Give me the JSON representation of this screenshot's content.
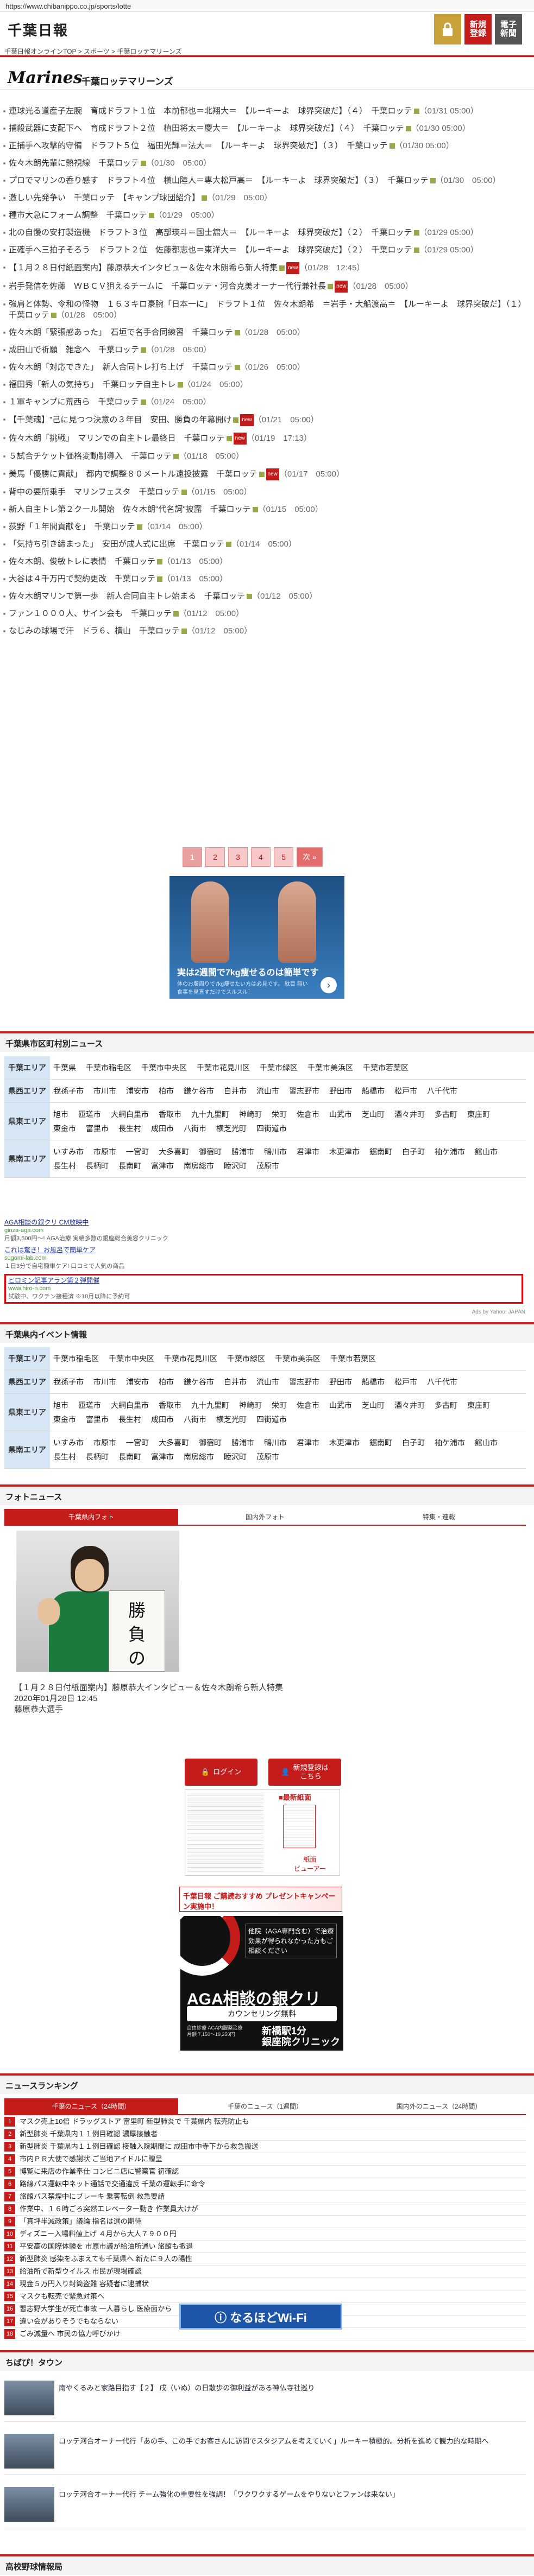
{
  "url": "https://www.chibanippo.co.jp/sports/lotte",
  "header": {
    "logo": "千葉日報",
    "btn_login": "",
    "btn_register": "新規\n登録",
    "btn_digital": "電子\n新聞"
  },
  "breadcrumb": "千葉日報オンラインTOP > スポーツ > 千葉ロッテマリーンズ",
  "team": {
    "logo": "Marines",
    "name": "千葉ロッテマリーンズ"
  },
  "news": [
    {
      "text": "連球光る道産子左腕　育成ドラフト１位　本前郁也＝北翔大＝　【ルーキーよ　球界突破だ】（４）　千葉ロッテ",
      "date": "（01/31 05:00）",
      "badge": ""
    },
    {
      "text": "捕殺武器に支配下へ　育成ドラフト２位　植田将太＝慶大＝　【ルーキーよ　球界突破だ】（４）　千葉ロッテ",
      "date": "（01/30 05:00）",
      "badge": ""
    },
    {
      "text": "正捕手へ攻撃的守備　ドラフト５位　福田光輝＝法大＝　【ルーキーよ　球界突破だ】（３）　千葉ロッテ",
      "date": "（01/30 05:00）",
      "badge": ""
    },
    {
      "text": "佐々木朗先輩に熱視線　千葉ロッテ",
      "date": "（01/30　05:00）",
      "badge": ""
    },
    {
      "text": "プロでマリンの香り感す　ドラフト４位　横山陸人＝専大松戸高＝　【ルーキーよ　球界突破だ】（３）　千葉ロッテ",
      "date": "（01/30　05:00）",
      "badge": ""
    },
    {
      "text": "激しい先発争い　千葉ロッテ　【キャンプ球団紹介】",
      "date": "（01/29　05:00）",
      "badge": ""
    },
    {
      "text": "種市大急にフォーム調整　千葉ロッテ",
      "date": "（01/29　05:00）",
      "badge": ""
    },
    {
      "text": "北の自慢の安打製造機　ドラフト３位　高部瑛斗＝国士舘大＝　【ルーキーよ　球界突破だ】（２）　千葉ロッテ",
      "date": "（01/29 05:00）",
      "badge": ""
    },
    {
      "text": "正確手へ三拍子そろう　ドラフト２位　佐藤都志也＝東洋大＝　【ルーキーよ　球界突破だ】（２）　千葉ロッテ",
      "date": "（01/29 05:00）",
      "badge": ""
    },
    {
      "text": "【１月２８日付紙面案内】藤原恭大インタビュー＆佐々木朗希ら新人特集",
      "date": "（01/28　12:45）",
      "badge": "new"
    },
    {
      "text": "岩手発信を佐藤　ＷＢＣＶ狙えるチームに　千葉ロッテ・河合克美オーナー代行兼社長",
      "date": "（01/28　05:00）",
      "badge": "new"
    },
    {
      "text": "強肩と体勢、令和の怪物　１６３キロ豪腕「日本一に」　ドラフト１位　佐々木朗希　＝岩手・大船渡高＝　【ルーキーよ　球界突破だ】（１）　千葉ロッテ",
      "date": "（01/28　05:00）",
      "badge": ""
    },
    {
      "text": "佐々木朗「緊張感あった」　石垣で名手合同練習　千葉ロッテ",
      "date": "（01/28　05:00）",
      "badge": ""
    },
    {
      "text": "成田山で祈願　雑念へ　千葉ロッテ",
      "date": "（01/28　05:00）",
      "badge": ""
    },
    {
      "text": "佐々木朗「対応できた」　新人合同トレ打ち上げ　千葉ロッテ",
      "date": "（01/26　05:00）",
      "badge": ""
    },
    {
      "text": "福田秀「新人の気持ち」　千葉ロッテ自主トレ",
      "date": "（01/24　05:00）",
      "badge": ""
    },
    {
      "text": "１軍キャンプに荒西ら　千葉ロッテ",
      "date": "（01/24　05:00）",
      "badge": ""
    },
    {
      "text": "【千葉魂】\"己に見つつ決意の３年目　安田、勝負の年幕開け",
      "date": "（01/21　05:00）",
      "badge": "new"
    },
    {
      "text": "佐々木朗「挑戦」　マリンでの自主トレ最終日　千葉ロッテ",
      "date": "（01/19　17:13）",
      "badge": "new"
    },
    {
      "text": "５試合チケット価格変動制導入　千葉ロッテ",
      "date": "（01/18　05:00）",
      "badge": ""
    },
    {
      "text": "美馬「優勝に貢献」　都内で調整８０メートル遠投披露　千葉ロッテ",
      "date": "（01/17　05:00）",
      "badge": "new"
    },
    {
      "text": "背中の要所乗手　マリンフェスタ　千葉ロッテ",
      "date": "（01/15　05:00）",
      "badge": ""
    },
    {
      "text": "新人自主トレ第２クール開始　佐々木朗\"代名詞\"披露　千葉ロッテ",
      "date": "（01/15　05:00）",
      "badge": ""
    },
    {
      "text": "荻野「１年間貢献を」　千葉ロッテ",
      "date": "（01/14　05:00）",
      "badge": ""
    },
    {
      "text": "「気持ち引き締まった」　安田が成人式に出席　千葉ロッテ",
      "date": "（01/14　05:00）",
      "badge": ""
    },
    {
      "text": "佐々木朗、俊敏トレに表情　千葉ロッテ",
      "date": "（01/13　05:00）",
      "badge": ""
    },
    {
      "text": "大谷は４千万円で契約更改　千葉ロッテ",
      "date": "（01/13　05:00）",
      "badge": ""
    },
    {
      "text": "佐々木朗マリンで第一歩　新人合同自主トレ始まる　千葉ロッテ",
      "date": "（01/12　05:00）",
      "badge": ""
    },
    {
      "text": "ファン１０００人、サイン会も　千葉ロッテ",
      "date": "（01/12　05:00）",
      "badge": ""
    },
    {
      "text": "なじみの球場で汗　ドラ６、横山　千葉ロッテ",
      "date": "（01/12　05:00）",
      "badge": ""
    }
  ],
  "pager": [
    "1",
    "2",
    "3",
    "4",
    "5",
    "次 »"
  ],
  "ad_main": {
    "headline": "実は2週間で7kg痩せるのは簡単です",
    "sub": "体のお腹周りで7kg痩せたい方は必見です。 駄目 無い食事を見直すだけでスルスル！"
  },
  "section_city": "千葉県市区町村別ニュース",
  "areas_city": [
    {
      "label": "千葉エリア",
      "items": [
        "千葉県",
        "千葉市稲毛区",
        "千葉市中央区",
        "千葉市花見川区",
        "千葉市緑区",
        "千葉市美浜区",
        "千葉市若葉区"
      ]
    },
    {
      "label": "県西エリア",
      "items": [
        "我孫子市",
        "市川市",
        "浦安市",
        "柏市",
        "鎌ケ谷市",
        "白井市",
        "流山市",
        "習志野市",
        "野田市",
        "船橋市",
        "松戸市",
        "八千代市"
      ]
    },
    {
      "label": "県東エリア",
      "items": [
        "旭市",
        "匝瑳市",
        "大網白里市",
        "香取市",
        "九十九里町",
        "神崎町",
        "栄町",
        "佐倉市",
        "山武市",
        "芝山町",
        "酒々井町",
        "多古町",
        "東庄町",
        "東金市",
        "富里市",
        "長生村",
        "成田市",
        "八街市",
        "横芝光町",
        "四街道市"
      ]
    },
    {
      "label": "県南エリア",
      "items": [
        "いすみ市",
        "市原市",
        "一宮町",
        "大多喜町",
        "御宿町",
        "勝浦市",
        "鴨川市",
        "君津市",
        "木更津市",
        "鋸南町",
        "白子町",
        "袖ケ浦市",
        "館山市",
        "長生村",
        "長柄町",
        "長南町",
        "富津市",
        "南房総市",
        "睦沢町",
        "茂原市"
      ]
    }
  ],
  "text_ads": [
    {
      "title": "AGA相談の銀クリ CM放映中",
      "url": "ginza-aga.com",
      "desc": "月額3,500円〜! AGA治療 実績多数の銀座総合美容クリニック"
    },
    {
      "title": "これは驚き！お風呂で簡単ケア",
      "url": "sugomi-lab.com",
      "desc": "１日3分で自宅簡単ケア! 口コミで人気の商品"
    },
    {
      "title": "ヒロミン記事アラン第２弾開催",
      "url": "www.hiro-n.com",
      "desc": "試験中、ワクチン接種済 ※10月以降に予約可"
    }
  ],
  "ads_by": "Ads by Yahoo! JAPAN",
  "section_event": "千葉県内イベント情報",
  "areas_event": [
    {
      "label": "千葉エリア",
      "items": [
        "千葉市稲毛区",
        "千葉市中央区",
        "千葉市花見川区",
        "千葉市緑区",
        "千葉市美浜区",
        "千葉市若葉区"
      ]
    },
    {
      "label": "県西エリア",
      "items": [
        "我孫子市",
        "市川市",
        "浦安市",
        "柏市",
        "鎌ケ谷市",
        "白井市",
        "流山市",
        "習志野市",
        "野田市",
        "船橋市",
        "松戸市",
        "八千代市"
      ]
    },
    {
      "label": "県東エリア",
      "items": [
        "旭市",
        "匝瑳市",
        "大網白里市",
        "香取市",
        "九十九里町",
        "神崎町",
        "栄町",
        "佐倉市",
        "山武市",
        "芝山町",
        "酒々井町",
        "多古町",
        "東庄町",
        "東金市",
        "富里市",
        "長生村",
        "成田市",
        "八街市",
        "横芝光町",
        "四街道市"
      ]
    },
    {
      "label": "県南エリア",
      "items": [
        "いすみ市",
        "市原市",
        "一宮町",
        "大多喜町",
        "御宿町",
        "勝浦市",
        "鴨川市",
        "君津市",
        "木更津市",
        "鋸南町",
        "白子町",
        "袖ケ浦市",
        "館山市",
        "長生村",
        "長柄町",
        "長南町",
        "富津市",
        "南房総市",
        "睦沢町",
        "茂原市"
      ]
    }
  ],
  "section_photo": "フォトニュース",
  "photo_tabs": [
    "千葉県内フォト",
    "国内外フォト",
    "特集・連載"
  ],
  "photo": {
    "board": "勝\n負\nの\n年",
    "caption1": "【１月２８日付紙面案内】藤原恭大インタビュー＆佐々木朗希ら新人特集",
    "caption2": "2020年01月28日 12:45",
    "caption3": "藤原恭大選手"
  },
  "login_btn": "ログイン",
  "register_btn": "新規登録は\nこちら",
  "viewer": {
    "label": "■最新紙面",
    "sub": "紙面\nビューアー"
  },
  "banner2": "千葉日報 ご購読おすすめ プレゼントキャンペーン実施中！",
  "aga": {
    "t1": "他院（AGA専門含む）で治療効果が得られなかった方もご相談ください",
    "t2": "AGA相談の銀クリ",
    "t3": "カウンセリング無料",
    "t4": "自由診療 AGA内服薬治療\n月額 7,150〜19,250円",
    "t5": "新橋駅1分\n銀座院クリニック"
  },
  "section_rank": "ニュースランキング",
  "rank_tabs": [
    "千葉のニュース（24時間）",
    "千葉のニュース（1週間）",
    "国内外のニュース（24時間）"
  ],
  "ranking": [
    "マスク売上10倍 ドラッグストア 富里町 新型肺炎で 千葉県内 転売防止も",
    "新型肺炎 千葉県内１１例目確認 濃厚接触者",
    "新型肺炎 千葉県内１１例目確認 接触入院期間に 成田市中寺下から救急搬送",
    "市内ＰＲ大使で感謝状 ご当地アイドルに贈呈",
    "博覧に来店の作業奉仕 コンビニ店に警察官 初確認",
    "路線パス運転中ネット通話で交通違反 千葉の運転手に命令",
    "旅館パス禁煙中にブレーキ 乗客転倒 救急要請",
    "作業中、１６時ごろ突然エレベーター動き 作業員大けが",
    "「真坪半減政策」議論 指名は選の期待",
    "ディズニー入場料値上げ ４月から大人７９００円",
    "平安高の国際体験を 市原市議が給油所通い 旅館も撤退",
    "新型肺炎 感染をふまえても千葉県へ 新たに９人の陽性",
    "給油所で新型ウイルス 市民が現場確認",
    "現金５万円入り封筒盗難 容疑者に逮捕状",
    "マスクも転売で緊急対策へ",
    "習志野大学生が死亡事故 一人暮らし 医療面から",
    "違い会がありそうでもならない",
    "ごみ減量へ 市民の協力呼びかけ"
  ],
  "wifi": "なるほどWi-Fi",
  "section_town": "ちばぴ！タウン",
  "town": [
    {
      "text": "南やくるみと家路目指す【２】 戌（いぬ）の日散歩の御利益がある神仏寺社巡り"
    },
    {
      "text": "ロッテ河合オーナー代行「あの手、この手でお客さんに訪問でスタジアムを考えていく」ルーキー積極的。分析を進めて観力的な時期へ"
    },
    {
      "text": "ロッテ河合オーナー代行 チーム強化の重要性を強調！「ワクワクするゲームをやりないとファンは来ない」"
    }
  ],
  "section_hs": "高校野球情報局"
}
